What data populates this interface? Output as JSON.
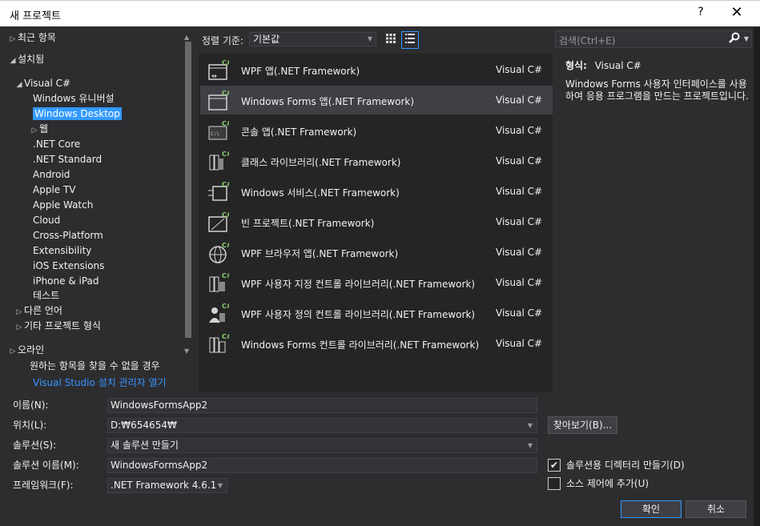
{
  "window": {
    "title": "새 프로젝트",
    "help": "?",
    "close": "✕"
  },
  "tree": {
    "items": [
      {
        "label": "최근 항목",
        "arrow": "▷"
      },
      {
        "label": "설치됨",
        "arrow": "◢"
      },
      {
        "label": "Visual C#",
        "arrow": "◢"
      },
      {
        "label": "Windows 유니버설",
        "arrow": ""
      },
      {
        "label": "Windows Desktop",
        "arrow": ""
      },
      {
        "label": "웹",
        "arrow": "▷"
      },
      {
        "label": ".NET Core",
        "arrow": ""
      },
      {
        "label": ".NET Standard",
        "arrow": ""
      },
      {
        "label": "Android",
        "arrow": ""
      },
      {
        "label": "Apple TV",
        "arrow": ""
      },
      {
        "label": "Apple Watch",
        "arrow": ""
      },
      {
        "label": "Cloud",
        "arrow": ""
      },
      {
        "label": "Cross-Platform",
        "arrow": ""
      },
      {
        "label": "Extensibility",
        "arrow": ""
      },
      {
        "label": "iOS Extensions",
        "arrow": ""
      },
      {
        "label": "iPhone & iPad",
        "arrow": ""
      },
      {
        "label": "테스트",
        "arrow": ""
      },
      {
        "label": "다른 언어",
        "arrow": "▷"
      },
      {
        "label": "기타 프로젝트 형식",
        "arrow": "▷"
      },
      {
        "label": "오라인",
        "arrow": "▷"
      }
    ],
    "selected": "Windows Desktop",
    "note": "원하는 항목을 찾을 수 없을 경우",
    "link": "Visual Studio 설치 관리자 열기"
  },
  "sort": {
    "label": "정렬 기준:",
    "value": "기본값"
  },
  "templates": [
    {
      "name": "WPF 앱(.NET Framework)",
      "lang": "Visual C#",
      "icon": "wpf-app-icon"
    },
    {
      "name": "Windows Forms 앱(.NET Framework)",
      "lang": "Visual C#",
      "icon": "windows-forms-app-icon"
    },
    {
      "name": "콘솔 앱(.NET Framework)",
      "lang": "Visual C#",
      "icon": "console-app-icon"
    },
    {
      "name": "클래스 라이브러리(.NET Framework)",
      "lang": "Visual C#",
      "icon": "class-library-icon"
    },
    {
      "name": "Windows 서비스(.NET Framework)",
      "lang": "Visual C#",
      "icon": "windows-service-icon"
    },
    {
      "name": "빈 프로젝트(.NET Framework)",
      "lang": "Visual C#",
      "icon": "empty-project-icon"
    },
    {
      "name": "WPF 브라우저 앱(.NET Framework)",
      "lang": "Visual C#",
      "icon": "wpf-browser-app-icon"
    },
    {
      "name": "WPF 사용자 지정 컨트롤 라이브러리(.NET Framework)",
      "lang": "Visual C#",
      "icon": "wpf-custom-control-library-icon"
    },
    {
      "name": "WPF 사용자 정의 컨트롤 라이브러리(.NET Framework)",
      "lang": "Visual C#",
      "icon": "wpf-user-control-library-icon"
    },
    {
      "name": "Windows Forms 컨트롤 라이브러리(.NET Framework)",
      "lang": "Visual C#",
      "icon": "windows-forms-control-library-icon"
    }
  ],
  "search": {
    "placeholder": "검색(Ctrl+E)"
  },
  "details": {
    "type_label": "형식:",
    "type_value": "Visual C#",
    "description": "Windows Forms 사용자 인터페이스를 사용하여 응용 프로그램을 만드는 프로젝트입니다."
  },
  "form": {
    "name_label": "이름(N):",
    "name_value": "WindowsFormsApp2",
    "location_label": "위치(L):",
    "location_value": "D:₩654654₩",
    "solution_label": "솔루션(S):",
    "solution_value": "새 솔루션 만들기",
    "solution_name_label": "솔루션 이름(M):",
    "solution_name_value": "WindowsFormsApp2",
    "framework_label": "프레임워크(F):",
    "framework_value": ".NET Framework 4.6.1",
    "browse_label": "찾아보기(B)...",
    "create_dir_label": "솔루션용 디렉터리 만들기(D)",
    "create_dir_checked": true,
    "source_control_label": "소스 제어에 추가(U)",
    "source_control_checked": false,
    "ok_label": "확인",
    "cancel_label": "취소"
  }
}
